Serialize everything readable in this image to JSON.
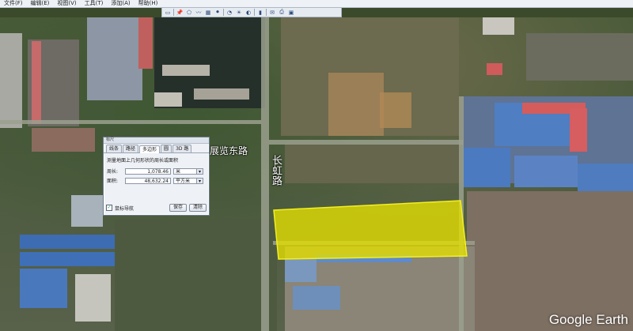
{
  "menu": {
    "items": [
      "文件(F)",
      "编辑(E)",
      "视图(V)",
      "工具(T)",
      "添加(A)",
      "帮助(H)"
    ]
  },
  "toolbar": {
    "icons": [
      "placemark-icon",
      "polygon-icon",
      "path-icon",
      "overlay-icon",
      "record-tour-icon",
      "historical-imagery-icon",
      "sun-icon",
      "planets-icon",
      "ruler-icon",
      "email-icon",
      "print-icon",
      "save-image-icon",
      "maps-icon"
    ]
  },
  "map": {
    "labels": {
      "road_east": "展览东路",
      "road_vertical": "长虹路"
    },
    "polygon_fill": "#e6e000",
    "watermark": "Google Earth"
  },
  "dialog": {
    "title": "标尺",
    "tabs": [
      "线条",
      "路径",
      "多边形",
      "圆",
      "3D 路"
    ],
    "active_tab": "多边形",
    "description": "测量地面上几何形状的周长或面积",
    "perimeter": {
      "label": "周长:",
      "value": "1,078.46",
      "unit": "米"
    },
    "area": {
      "label": "面积:",
      "value": "48,632.24",
      "unit": "平方米"
    },
    "mouse_nav_label": "鼠标导航",
    "save_label": "保存",
    "clear_label": "清除"
  }
}
